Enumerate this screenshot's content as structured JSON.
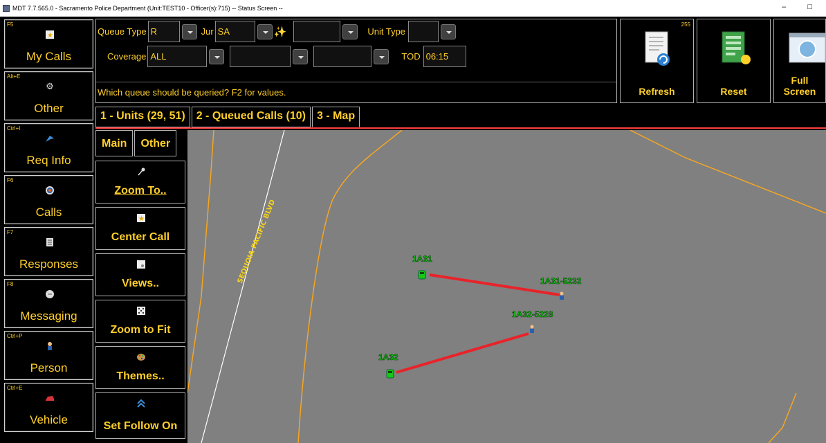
{
  "window": {
    "title": "MDT 7.7.565.0 - Sacramento Police Department  (Unit:TEST10 - Officer(s):715)  -- Status Screen --",
    "controls": "– □"
  },
  "sidebar": {
    "items": [
      {
        "key": "F5",
        "label": "My Calls",
        "icon": "star-doc-icon"
      },
      {
        "key": "Alt+E",
        "label": "Other",
        "icon": "gear-icon"
      },
      {
        "key": "Ctrl+I",
        "label": "Req Info",
        "icon": "bird-icon"
      },
      {
        "key": "F6",
        "label": "Calls",
        "icon": "target-icon"
      },
      {
        "key": "F7",
        "label": "Responses",
        "icon": "document-icon"
      },
      {
        "key": "F8",
        "label": "Messaging",
        "icon": "chat-bubble-icon"
      },
      {
        "key": "Ctrl+P",
        "label": "Person",
        "icon": "person-icon"
      },
      {
        "key": "Ctrl+E",
        "label": "Vehicle",
        "icon": "car-icon"
      }
    ]
  },
  "query": {
    "queue_type_label": "Queue Type",
    "queue_type_value": "R",
    "jur_label": "Jur",
    "jur_value": "SA",
    "extra_value": "",
    "unit_type_label": "Unit Type",
    "unit_type_value": "",
    "coverage_label": "Coverage",
    "coverage_value": "ALL",
    "coverage2_value": "",
    "coverage3_value": "",
    "tod_label": "TOD",
    "tod_value": "06:15",
    "hint": "Which queue should be queried?  F2 for values."
  },
  "toolbar": {
    "refresh_label": "Refresh",
    "refresh_count": "255",
    "reset_label": "Reset",
    "fullscreen_label": "Full Screen"
  },
  "tabs": [
    {
      "label": "1 - Units (29, 51)"
    },
    {
      "label": "2 - Queued Calls (10)"
    },
    {
      "label": "3 - Map"
    }
  ],
  "map_tabs": [
    {
      "label": "Main"
    },
    {
      "label": "Other"
    }
  ],
  "map_buttons": [
    {
      "label": "Zoom To..",
      "icon": "pin-icon"
    },
    {
      "label": "Center Call",
      "icon": "star-doc-icon"
    },
    {
      "label": "Views..",
      "icon": "views-icon"
    },
    {
      "label": "Zoom to Fit",
      "icon": "dice-icon"
    },
    {
      "label": "Themes..",
      "icon": "palette-icon"
    },
    {
      "label": "Set Follow On",
      "icon": "chevrons-up-icon"
    }
  ],
  "map": {
    "street_label": "SEQUOIA PACIFIC BLVD",
    "units": [
      {
        "label": "1A31"
      },
      {
        "label": "1A32"
      }
    ],
    "calls": [
      {
        "label": "1A31-5232"
      },
      {
        "label": "1A32-5228"
      }
    ],
    "colors": {
      "background": "#808080",
      "road": "#f5a623",
      "route": "#e8232a",
      "unit": "#17c817"
    }
  }
}
